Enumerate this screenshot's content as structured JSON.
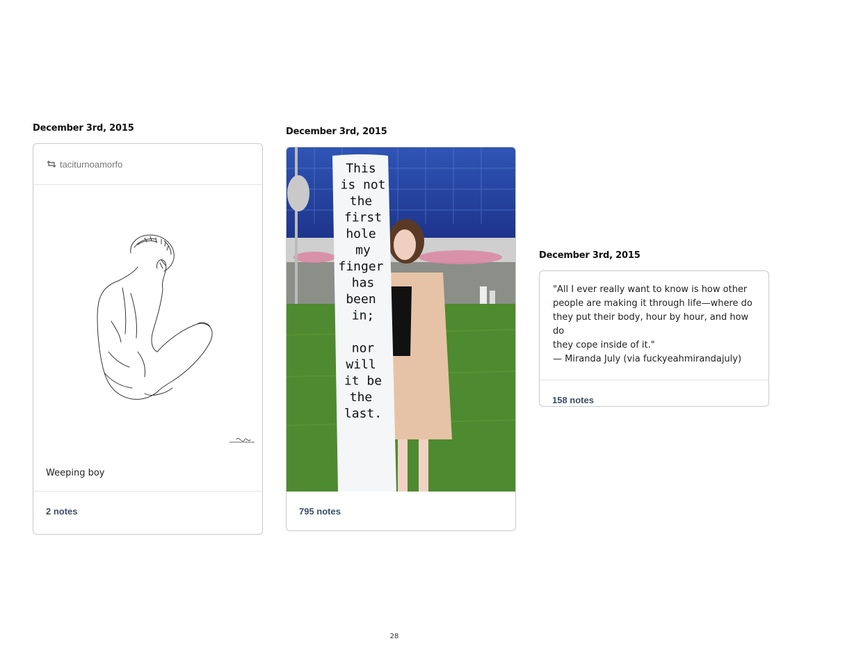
{
  "posts": [
    {
      "date": "December 3rd, 2015",
      "reblog_user": "taciturnoamorfo",
      "image": "line drawing of a seated nude boy covering his face",
      "caption": "Weeping boy",
      "notes": "2 notes"
    },
    {
      "date": "December 3rd, 2015",
      "image": "woman standing on grass beside a tall white sign",
      "sign_text": [
        "This",
        "is not",
        "the",
        "first",
        "hole",
        "my",
        "finger",
        "has",
        "been",
        "in;",
        "",
        "nor",
        "will",
        "it be",
        "the",
        "last."
      ],
      "notes": "795 notes"
    },
    {
      "date": "December 3rd, 2015",
      "quote_lines": [
        "\"All I ever really want to know is how other",
        "people are making it through life—where do",
        "they put their body, hour by hour, and how do",
        "they cope inside of it.\"",
        "— Miranda July (via fuckyeahmirandajuly)"
      ],
      "notes": "158 notes"
    }
  ],
  "page_number": "28",
  "icons": {
    "reblog": "reblog-icon"
  },
  "colors": {
    "notes_text": "#3b5068",
    "border": "#c9c9c9"
  }
}
